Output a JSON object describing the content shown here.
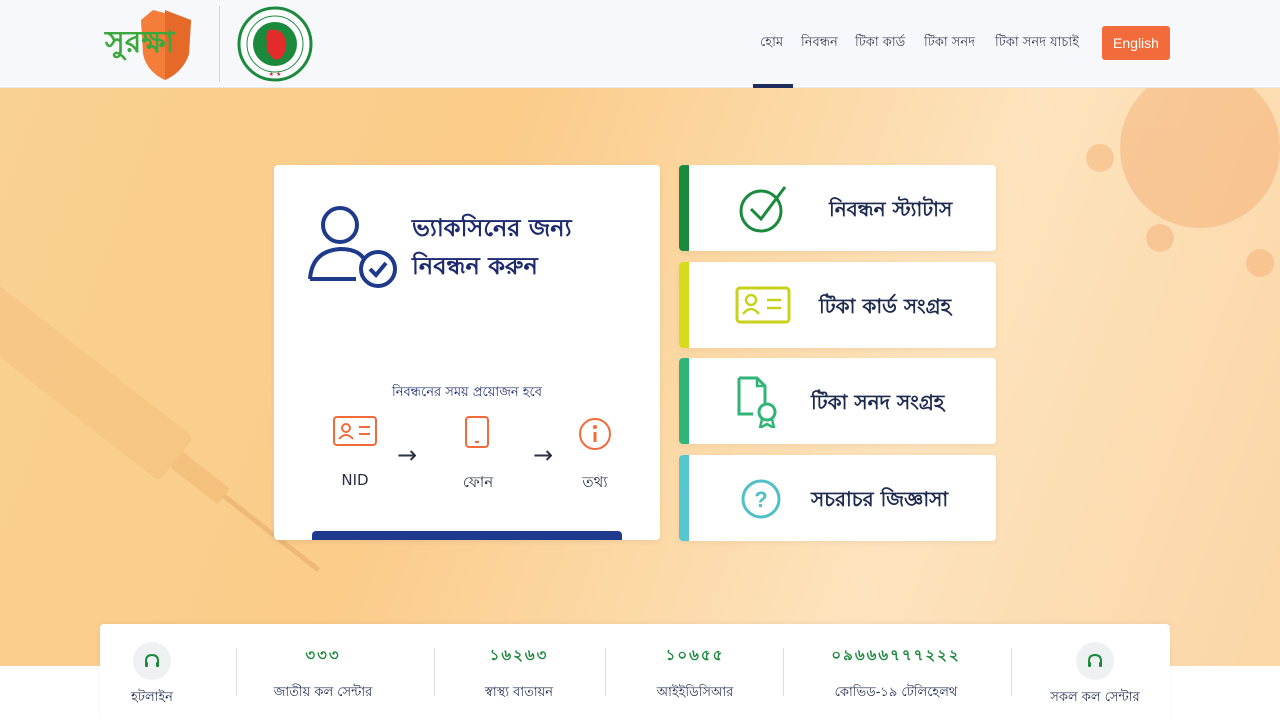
{
  "header": {
    "logo_text": "সুরক্ষা",
    "nav": [
      {
        "label": "হোম",
        "active": true
      },
      {
        "label": "নিবন্ধন",
        "active": false
      },
      {
        "label": "টিকা কার্ড",
        "active": false
      },
      {
        "label": "টিকা সনদ",
        "active": false
      },
      {
        "label": "টিকা সনদ যাচাই",
        "active": false
      }
    ],
    "language_button": "English"
  },
  "register_card": {
    "title_line1": "ভ্যাকসিনের জন্য",
    "title_line2": "নিবন্ধন করুন",
    "requirements_title": "নিবন্ধনের সময় প্রয়োজন হবে",
    "requirements": [
      {
        "label": "NID",
        "icon": "id-card-icon"
      },
      {
        "label": "ফোন",
        "icon": "phone-icon"
      },
      {
        "label": "তথ্য",
        "icon": "info-icon"
      }
    ]
  },
  "options": [
    {
      "label": "নিবন্ধন স্ট্যাটাস",
      "icon": "check-circle-icon",
      "color": "#1c8a3d"
    },
    {
      "label": "টিকা কার্ড সংগ্রহ",
      "icon": "id-card-icon",
      "color": "#d6dc1c"
    },
    {
      "label": "টিকা সনদ সংগ্রহ",
      "icon": "certificate-icon",
      "color": "#2fb575"
    },
    {
      "label": "সচরাচর জিজ্ঞাসা",
      "icon": "question-icon",
      "color": "#56c6cf"
    }
  ],
  "hotlines": [
    {
      "number": "",
      "label": "হটলাইন",
      "icon": "headset-icon"
    },
    {
      "number": "৩৩৩",
      "label": "জাতীয় কল সেন্টার"
    },
    {
      "number": "১৬২৬৩",
      "label": "স্বাস্থ্য বাতায়ন"
    },
    {
      "number": "১০৬৫৫",
      "label": "আইইডিসিআর"
    },
    {
      "number": "০৯৬৬৬৭৭৭২২২",
      "label": "কোভিড-১৯ টেলিহেলথ"
    },
    {
      "number": "",
      "label": "সকল কল সেন্টার",
      "icon": "headset-icon"
    }
  ],
  "colors": {
    "brand_green": "#2aa845",
    "accent_orange": "#f26b3a",
    "navy": "#1e2a6e",
    "hero_bg": "#fbcc8a"
  }
}
